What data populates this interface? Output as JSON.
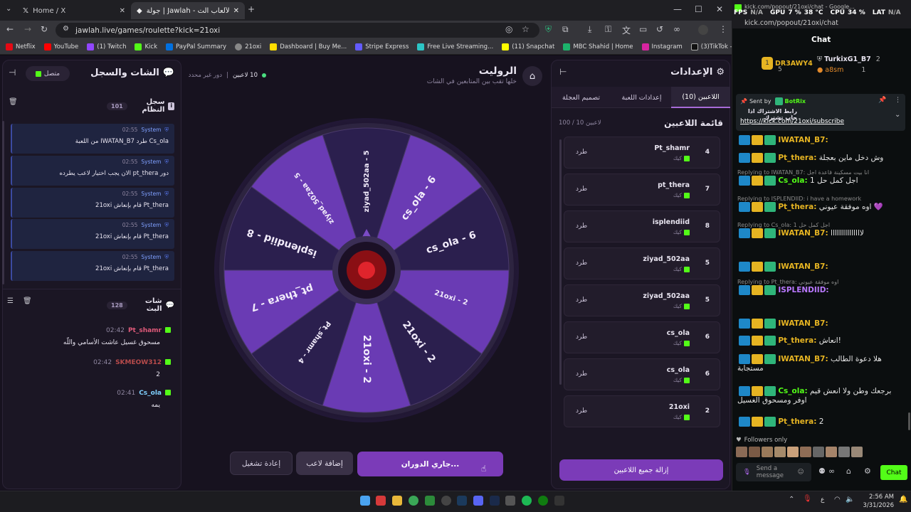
{
  "browser": {
    "tabs": [
      {
        "title": "Home / X"
      },
      {
        "title": "جولة | Jawlah - منصة الألعاب الت..."
      }
    ],
    "url": "jawlah.live/games/roulette?kick=21oxi",
    "bookmarks": [
      "Netflix",
      "YouTube",
      "(1) Twitch",
      "Kick",
      "PayPal Summary",
      "21oxi",
      "Dashboard | Buy Me...",
      "Stripe Express",
      "Free Live Streaming...",
      "(11) Snapchat",
      "MBC Shahid | Home",
      "Instagram",
      "(3)TikTok - Make Yo..."
    ]
  },
  "left_panel": {
    "title": "الشات والسجل",
    "status": "متصل",
    "system_log": {
      "title": "سجل النظام",
      "count": "101"
    },
    "log_entries": [
      {
        "author": "System",
        "time": "02:55",
        "text": "Cs_ola طرد IWATAN_B7 من اللعبة"
      },
      {
        "author": "System",
        "time": "02:55",
        "text": "دور pt_thera الان يجب اختيار لاعب يطرده"
      },
      {
        "author": "System",
        "time": "02:55",
        "text": "Pt_thera قام بإنعاش 21oxi"
      },
      {
        "author": "System",
        "time": "02:55",
        "text": "Pt_thera قام بإنعاش 21oxi"
      },
      {
        "author": "System",
        "time": "02:55",
        "text": "Pt_thera قام بإنعاش 21oxi"
      }
    ],
    "stream_chat": {
      "title": "شات البث",
      "count": "128"
    },
    "chat_entries": [
      {
        "user": "Pt_shamr",
        "time": "02:42",
        "text": "مسحوق غسيل عاشت الأسامي واللّه",
        "color": "#e05a7a"
      },
      {
        "user": "SKMEOW312",
        "time": "02:42",
        "text": "2",
        "color": "#b84b4b"
      },
      {
        "user": "Cs_ola",
        "time": "02:41",
        "text": "يمه",
        "color": "#7fd0ff"
      }
    ]
  },
  "game": {
    "title": "الروليت",
    "subtitle": "خلها تقب بين المتابعين في الشات",
    "players_count": "10 لاعبين",
    "round": "دور غير محدد",
    "wheel_segments": [
      "ziyad_502aa - 5",
      "cs_ola - 6",
      "cs_ola - 6",
      "21oxi - 2",
      "21oxi - 2",
      "21oxi - 2",
      "Pt_shamr - 4",
      "pt_thera - 7",
      "isplendiid - 8",
      "ziyad_502aa - 5"
    ],
    "buttons": {
      "spin": "جاري الدوران...",
      "add_player": "إضافة لاعب",
      "restart": "إعادة تشغيل"
    }
  },
  "settings_panel": {
    "title": "الإعدادات",
    "tabs": [
      "اللاعبين (10)",
      "إعدادات اللعبة",
      "تصميم العجلة"
    ],
    "list_title": "قائمة اللاعبين",
    "list_count": "100 / 10 لاعبين",
    "kick_label": "كيك",
    "kick_button": "طرد",
    "players": [
      {
        "name": "Pt_shamr",
        "num": "4"
      },
      {
        "name": "pt_thera",
        "num": "7"
      },
      {
        "name": "isplendiid",
        "num": "8"
      },
      {
        "name": "ziyad_502aa",
        "num": "5"
      },
      {
        "name": "ziyad_502aa",
        "num": "5"
      },
      {
        "name": "cs_ola",
        "num": "6"
      },
      {
        "name": "cs_ola",
        "num": "6"
      },
      {
        "name": "21oxi",
        "num": "2"
      }
    ],
    "remove_all": "إزالة جميع اللاعبين"
  },
  "chat_popout": {
    "url": "kick.com/popout/21oxi/chat - Google...",
    "url2": "kick.com/popout/21oxi/chat",
    "stats": {
      "fps_label": "FPS",
      "fps": "N/A",
      "gpu_label": "GPU",
      "gpu": "7 %",
      "gpu_temp": "38 °C",
      "cpu_label": "CPU",
      "cpu": "34 %",
      "lat_label": "LAT",
      "lat": "N/A"
    },
    "title": "Chat",
    "leaders": [
      {
        "name": "DR3AWY4",
        "value": "5"
      },
      {
        "name": "TurkixG1_B7",
        "value": "2"
      },
      {
        "name": "a8sm",
        "value": "1"
      }
    ],
    "pinned": {
      "sent_by": "Sent by",
      "bot": "BotRix",
      "text": "رابط الاشتراك اذا حاب تشترك",
      "link": "https://kick.com/21oxi/subscribe"
    },
    "messages": [
      {
        "user": "IWATAN_B7:",
        "text": "",
        "color": "#e6b422"
      },
      {
        "user": "Pt_thera:",
        "text": "وش دخل ماين بعجلة",
        "color": "#e6b422"
      },
      {
        "reply": "Replying to IWATAN_B7: انا بيت مسكينة قاعدة اجل",
        "user": "Cs_ola:",
        "text": "اجل كمل حل 1",
        "color": "#53fc18"
      },
      {
        "reply": "Replying to ISPLENDIID: i have a homework",
        "user": "Pt_thera:",
        "text": "اوه موفقة عيوني 💜",
        "color": "#e6b422"
      },
      {
        "reply": "Replying to Cs_ola: اجل كمل حل 1",
        "user": "IWATAN_B7:",
        "text": "لااااااااااااااا",
        "color": "#e6b422"
      },
      {
        "user": "IWATAN_B7:",
        "text": "",
        "color": "#e6b422"
      },
      {
        "reply": "Replying to Pt_thera: اوه موفقة عيوني",
        "user": "ISPLENDIID:",
        "text": "",
        "color": "#b978ff"
      },
      {
        "user": "IWATAN_B7:",
        "text": "",
        "color": "#e6b422"
      },
      {
        "user": "Pt_thera:",
        "text": "انعاش!",
        "color": "#e6b422"
      },
      {
        "user": "IWATAN_B7:",
        "text": "هلا دعوة الطالب مستجابة",
        "color": "#e6b422"
      },
      {
        "user": "Cs_ola:",
        "text": "برجعك وطن ولا انعش قيم اوفر ومسحوق الغسيل",
        "color": "#53fc18"
      },
      {
        "user": "Pt_thera:",
        "text": "2",
        "color": "#e6b422"
      }
    ],
    "followers_only": "Followers only",
    "input_placeholder": "Send a message",
    "chat_button": "Chat"
  },
  "taskbar": {
    "time": "2:56 AM",
    "date": "3/31/2026",
    "lang": "ع"
  }
}
